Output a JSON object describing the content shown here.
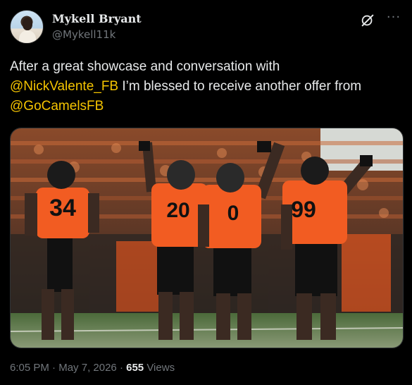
{
  "author": {
    "display_name": "Mykell Bryant",
    "handle": "@Mykell11k"
  },
  "icons": {
    "grok": "grok-icon",
    "more": "more-options-icon"
  },
  "tweet": {
    "line1": "After a great showcase and conversation with",
    "mention1": "@NickValente_FB",
    "line2_text": " I’m blessed to receive another offer from",
    "mention2": "@GoCamelsFB"
  },
  "media": {
    "jersey_numbers": [
      "34",
      "20",
      "0",
      "99"
    ],
    "jersey_color": "#f25c22"
  },
  "meta": {
    "time": "6:05 PM",
    "date": "May 7, 2026",
    "views_count": "655",
    "views_label": "Views",
    "sep": "·"
  },
  "colors": {
    "mention": "#f5c400",
    "background": "#000000",
    "secondary_text": "#71767b"
  }
}
